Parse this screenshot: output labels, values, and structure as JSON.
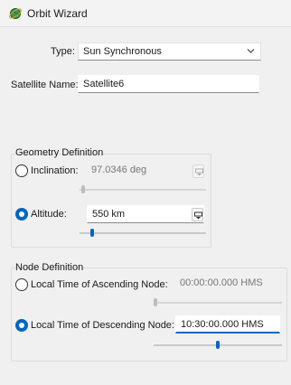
{
  "window": {
    "title": "Orbit Wizard",
    "icon": "globe-orbit-icon"
  },
  "type": {
    "label": "Type:",
    "value": "Sun Synchronous"
  },
  "satellite": {
    "label": "Satellite Name:",
    "value": "Satellite6"
  },
  "geometry": {
    "title": "Geometry Definition",
    "inclination": {
      "label": "Inclination:",
      "value": "97.0346 deg",
      "selected": false,
      "slider_level": 0.02
    },
    "altitude": {
      "label": "Altitude:",
      "value": "550 km",
      "selected": true,
      "slider_level": 0.1
    }
  },
  "node": {
    "title": "Node Definition",
    "ascending": {
      "label": "Local Time of Ascending Node:",
      "value": "00:00:00.000 HMS",
      "selected": false,
      "slider_level": 0.0
    },
    "descending": {
      "label": "Local Time of Descending Node:",
      "value": "10:30:00.000 HMS",
      "selected": true,
      "slider_level": 0.5
    }
  },
  "colors": {
    "accent": "#0067c0",
    "background": "#f0f0f0"
  }
}
